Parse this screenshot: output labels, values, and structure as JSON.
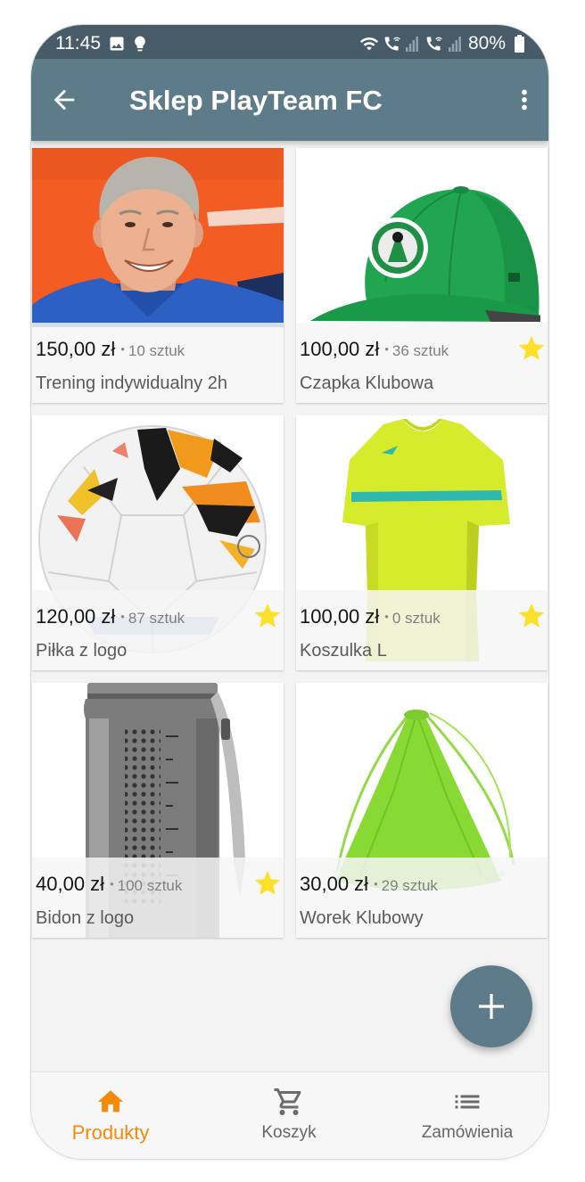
{
  "status_bar": {
    "time": "11:45",
    "battery_level": "80%",
    "left_icons": [
      "gallery-icon",
      "bulb-icon"
    ],
    "right_icons": [
      "wifi-icon",
      "wifi-call-icon",
      "signal-icon",
      "volte-call-icon",
      "signal-icon",
      "battery-icon"
    ]
  },
  "app_bar": {
    "title": "Sklep PlayTeam FC",
    "back_icon": "arrow-back-icon",
    "menu_icon": "more-vert-icon"
  },
  "product_list": {
    "stock_separator": "•",
    "favorite_icon": "star-icon",
    "items": [
      {
        "price": "150,00 zł",
        "stock": "10 sztuk",
        "name": "Trening indywidualny 2h",
        "starred": false,
        "image": "coach-photo"
      },
      {
        "price": "100,00 zł",
        "stock": "36 sztuk",
        "name": "Czapka Klubowa",
        "starred": true,
        "image": "green-cap"
      },
      {
        "price": "120,00 zł",
        "stock": "87 sztuk",
        "name": "Piłka z logo",
        "starred": true,
        "image": "soccer-ball"
      },
      {
        "price": "100,00 zł",
        "stock": "0 sztuk",
        "name": "Koszulka L",
        "starred": true,
        "image": "lime-jersey"
      },
      {
        "price": "40,00 zł",
        "stock": "100 sztuk",
        "name": "Bidon z logo",
        "starred": true,
        "image": "water-bottle"
      },
      {
        "price": "30,00 zł",
        "stock": "29 sztuk",
        "name": "Worek Klubowy",
        "starred": false,
        "image": "drawstring-bag"
      }
    ]
  },
  "fab": {
    "icon": "plus-icon"
  },
  "bottom_nav": {
    "items": [
      {
        "label": "Produkty",
        "icon": "home-icon",
        "active": true
      },
      {
        "label": "Koszyk",
        "icon": "cart-icon",
        "active": false
      },
      {
        "label": "Zamówienia",
        "icon": "list-icon",
        "active": false
      }
    ]
  },
  "colors": {
    "status_bar": "#475c68",
    "app_bar": "#5e7b89",
    "accent": "#f4890b",
    "star": "#fce02a",
    "background": "#f3f3f3"
  }
}
